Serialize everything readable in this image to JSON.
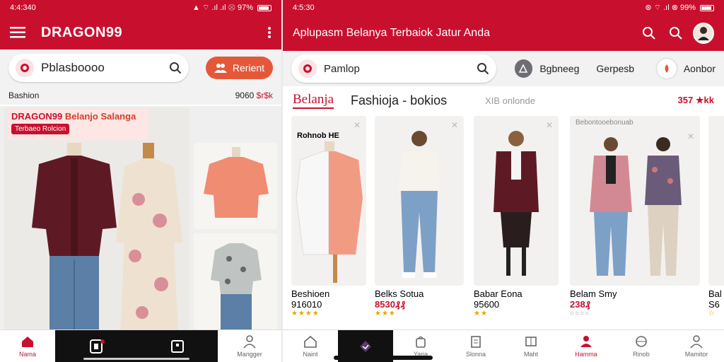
{
  "left": {
    "status": {
      "time": "4:4:340",
      "right": "▲ ⌔ .ıl .ıl ⊗ 97%"
    },
    "app_title": "DRAGON99",
    "search_text": "Pblasboooo",
    "pill_label": "Rerient",
    "section_label": "Bashion",
    "section_price": "9060",
    "section_price_red": "$r$k",
    "banner_title": "DRAGON99",
    "banner_sub": "Belanjo Salanga",
    "banner_tag": "Terbaeo Rolcion",
    "nav": [
      {
        "label": "Nama",
        "icon": "home-icon",
        "active": true
      },
      {
        "label": "",
        "icon": "phone-icon",
        "active": false
      },
      {
        "label": "",
        "icon": "square-icon",
        "active": false
      },
      {
        "label": "Mangger",
        "icon": "person-icon",
        "active": false
      }
    ]
  },
  "right": {
    "status": {
      "time": "4:5:30",
      "right": "⊛ ⌔ .ıl ⊗ 99%"
    },
    "app_title": "Aplupasm Belanya Terbaiok Jatur Anda",
    "search_text": "Pamlop",
    "tab_a": "Bgbneeg",
    "tab_b": "Gerpesb",
    "tab_c": "Aonbor",
    "heading_red": "Belanja",
    "heading_black": "Fashioja - bokios",
    "heading_grey": "XIB onlonde",
    "heading_price": "357",
    "heading_price_suffix": "★kk",
    "products": [
      {
        "tag": "Rohnob HE",
        "name": "Beshioen",
        "price": "916010",
        "price_red": false,
        "stars": "★★★★"
      },
      {
        "tag": "",
        "name": "Belks Sotua",
        "price": "8530₰₰",
        "price_red": true,
        "stars": "★★★"
      },
      {
        "tag": "",
        "name": "Babar Eona",
        "price": "95600",
        "price_red": false,
        "stars": "★★"
      },
      {
        "tag": "Bebontooebonuab",
        "name": "Belam Smy",
        "price": "238₰",
        "price_red": true,
        "stars": "○○○○"
      },
      {
        "tag": "",
        "name": "Bal",
        "price": "S6",
        "price_red": false,
        "stars": "☆"
      }
    ],
    "nav": [
      {
        "label": "Naint",
        "icon": "home-icon",
        "active": false
      },
      {
        "label": "",
        "icon": "diamond-icon",
        "active": false
      },
      {
        "label": "Yaria",
        "icon": "bag-icon",
        "active": false
      },
      {
        "label": "Slonna",
        "icon": "receipt-icon",
        "active": false
      },
      {
        "label": "Maht",
        "icon": "grid-icon",
        "active": false
      },
      {
        "label": "Hamma",
        "icon": "people-icon",
        "active": true
      },
      {
        "label": "Rinob",
        "icon": "globe-icon",
        "active": false
      },
      {
        "label": "Mamitor",
        "icon": "person-icon",
        "active": false
      }
    ]
  }
}
